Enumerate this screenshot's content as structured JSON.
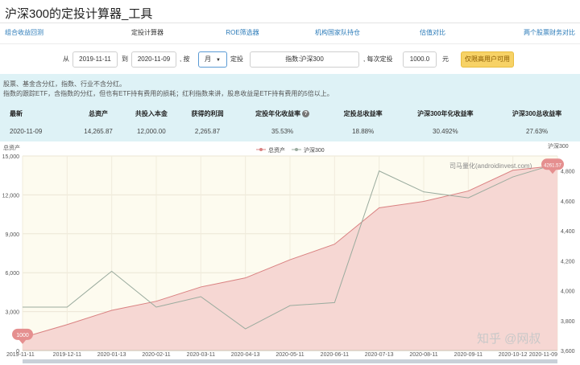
{
  "page": {
    "title": "沪深300的定投计算器_工具"
  },
  "nav": {
    "items": [
      "组合收益回测",
      "定投计算器",
      "ROE筛选器",
      "机构国家队持仓",
      "估值对比",
      "两个股票财务对比"
    ]
  },
  "form": {
    "from_label": "从",
    "start_date": "2019-11-11",
    "to_label": "到",
    "end_date": "2020-11-09",
    "per_label": ", 按",
    "period": "月",
    "invest_label": "定投",
    "index_name": "指数:沪深300",
    "amount_label": ", 每次定投",
    "amount": "1000.0",
    "unit": "元",
    "vip_button": "仅限高用户可用"
  },
  "notes": {
    "line1": "股票、基金含分红，指数、行业不含分红。",
    "line2": "指数的跟踪ETF，含指数的分红，但也有ETF持有费用的损耗；红利指数来讲，股息收益是ETF持有费用的5倍以上。"
  },
  "stats": {
    "headers": [
      "最新",
      "总资产",
      "共投入本金",
      "获得的利润",
      "定投年化收益率",
      "定投总收益率",
      "沪深300年化收益率",
      "沪深300总收益率"
    ],
    "values": [
      "2020-11-09",
      "14,265.87",
      "12,000.00",
      "2,265.87",
      "35.53%",
      "18.88%",
      "30.492%",
      "27.63%"
    ]
  },
  "chart_data": {
    "type": "line",
    "legend": [
      "总资产",
      "沪深300"
    ],
    "y_left_label": "总资产",
    "y_right_label": "沪深300",
    "watermark": "司马量化(androidinvest.com)",
    "brand": "知乎 @网叔",
    "start_marker": "1000",
    "end_marker": "4261.57",
    "x_labels": [
      "2019-11-11",
      "2019-12-11",
      "2020-01-13",
      "2020-02-11",
      "2020-03-11",
      "2020-04-13",
      "2020-05-11",
      "2020-06-11",
      "2020-07-13",
      "2020-08-11",
      "2020-09-11",
      "2020-10-12",
      "2020-11-09"
    ],
    "y_left_ticks": [
      "0",
      "3,000",
      "6,000",
      "9,000",
      "12,000",
      "15,000"
    ],
    "y_left_range": [
      0,
      15000
    ],
    "y_right_ticks": [
      "3,600",
      "3,800",
      "4,000",
      "4,200",
      "4,400",
      "4,600",
      "4,800"
    ],
    "y_right_range": [
      3600,
      4900
    ],
    "series": [
      {
        "name": "总资产",
        "color": "#d98080",
        "fill": "#f6d7d3",
        "axis": "left",
        "values": [
          1000,
          2000,
          3100,
          3800,
          4900,
          5600,
          7000,
          8200,
          11000,
          11500,
          12300,
          13900,
          14265.87
        ]
      },
      {
        "name": "沪深300",
        "color": "#9aab9e",
        "axis": "right",
        "values": [
          3890,
          3890,
          4130,
          3890,
          3960,
          3745,
          3900,
          3920,
          4800,
          4660,
          4620,
          4760,
          4850
        ]
      }
    ],
    "grid": true
  }
}
